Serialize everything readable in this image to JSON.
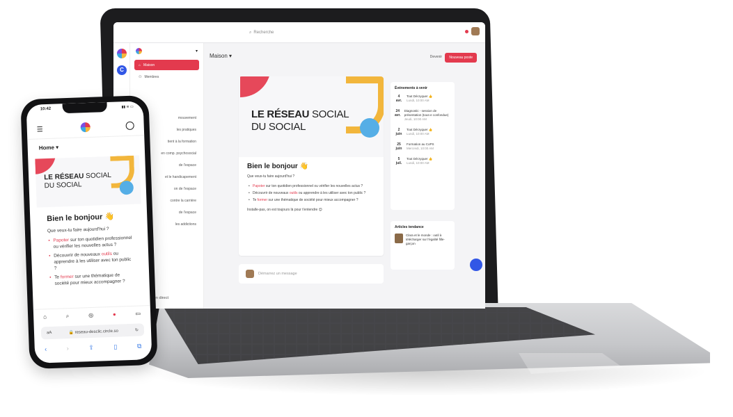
{
  "laptop": {
    "topbar": {
      "search_placeholder": "Recherche"
    },
    "sidebar": {
      "items": [
        {
          "label": "Maison"
        },
        {
          "label": "Membres"
        },
        {
          "label": "mouvement"
        },
        {
          "label": "les pratiques"
        },
        {
          "label": "tient à la formation"
        },
        {
          "label": "en comp. psychosocial"
        },
        {
          "label": "de l'espace"
        },
        {
          "label": "et le handicapement"
        },
        {
          "label": "on de l'espace"
        },
        {
          "label": "contre la carrière"
        },
        {
          "label": "de l'espace"
        },
        {
          "label": "les addictions"
        }
      ],
      "footer": "Allez en direct"
    },
    "main": {
      "heading": "Maison",
      "btn_light": "Devenir",
      "btn_red": "Nouveau poste",
      "banner": {
        "title_bold": "LE RÉSEAU",
        "title_rest1": "SOCIAL",
        "title_line2": "DU SOCIAL"
      },
      "welcome_title": "Bien le bonjour 👋",
      "question": "Que veux-tu faire aujourd'hui ?",
      "bullets": [
        {
          "pre": "",
          "hl": "Papoter",
          "post": " sur ton quotidien professionnel ou vérifier les nouvelles actus ?"
        },
        {
          "pre": "Découvrir de nouveaux ",
          "hl": "outils",
          "post": " ou apprendre à les utiliser avec ton public ?"
        },
        {
          "pre": "Te ",
          "hl": "former",
          "post": " sur une thématique de société pour mieux accompagner ?"
        }
      ],
      "ending": "Installe-pas, on est toujours là pour t'entendre 😊",
      "message_placeholder": "Démarrez un message"
    },
    "events": {
      "title": "Événements à venir",
      "items": [
        {
          "day": "4",
          "month": "avr.",
          "title": "Tout Décryquer 👍",
          "sub": "Lundi, 10:00 AM"
        },
        {
          "day": "24",
          "month": "avr.",
          "title": "Diagnostic - session de présentation (tous-e confondue)",
          "sub": "Jeudi, 10:00 AM"
        },
        {
          "day": "2",
          "month": "juin",
          "title": "Tout Décryquer 👍",
          "sub": "Lundi, 10:00 AM"
        },
        {
          "day": "25",
          "month": "juin",
          "title": "Formation au CoPS",
          "sub": "Mercredi, 10:00 AM"
        },
        {
          "day": "5",
          "month": "juil.",
          "title": "Tout Décryquer 👍",
          "sub": "Lundi, 10:00 AM"
        }
      ]
    },
    "articles": {
      "title": "Articles tendance",
      "item": "Clara et le monde : outil à télécharger sur l'égalité fille-garçon"
    }
  },
  "phone": {
    "status_time": "10:42",
    "status_right": "▮▮ ≋ ▭",
    "home_label": "Home ▾",
    "banner": {
      "title_bold": "LE RÉSEAU",
      "title_rest1": "SOCIAL",
      "title_line2": "DU SOCIAL"
    },
    "welcome_title": "Bien le bonjour 👋",
    "question": "Que veux-tu faire aujourd'hui ?",
    "bullets": [
      {
        "pre": "",
        "hl": "Papoter",
        "post": " sur ton quotidien professionnel ou vérifier les nouvelles actus ?"
      },
      {
        "pre": "Découvrir de nouveaux ",
        "hl": "outils",
        "post": " ou apprendre à les utiliser avec ton public ?"
      },
      {
        "pre": "Te ",
        "hl": "former",
        "post": " sur une thématique de société pour mieux accompagner ?"
      }
    ],
    "url_left": "aA",
    "url": "reseau-desclic.circle.so",
    "url_right": "↻"
  }
}
